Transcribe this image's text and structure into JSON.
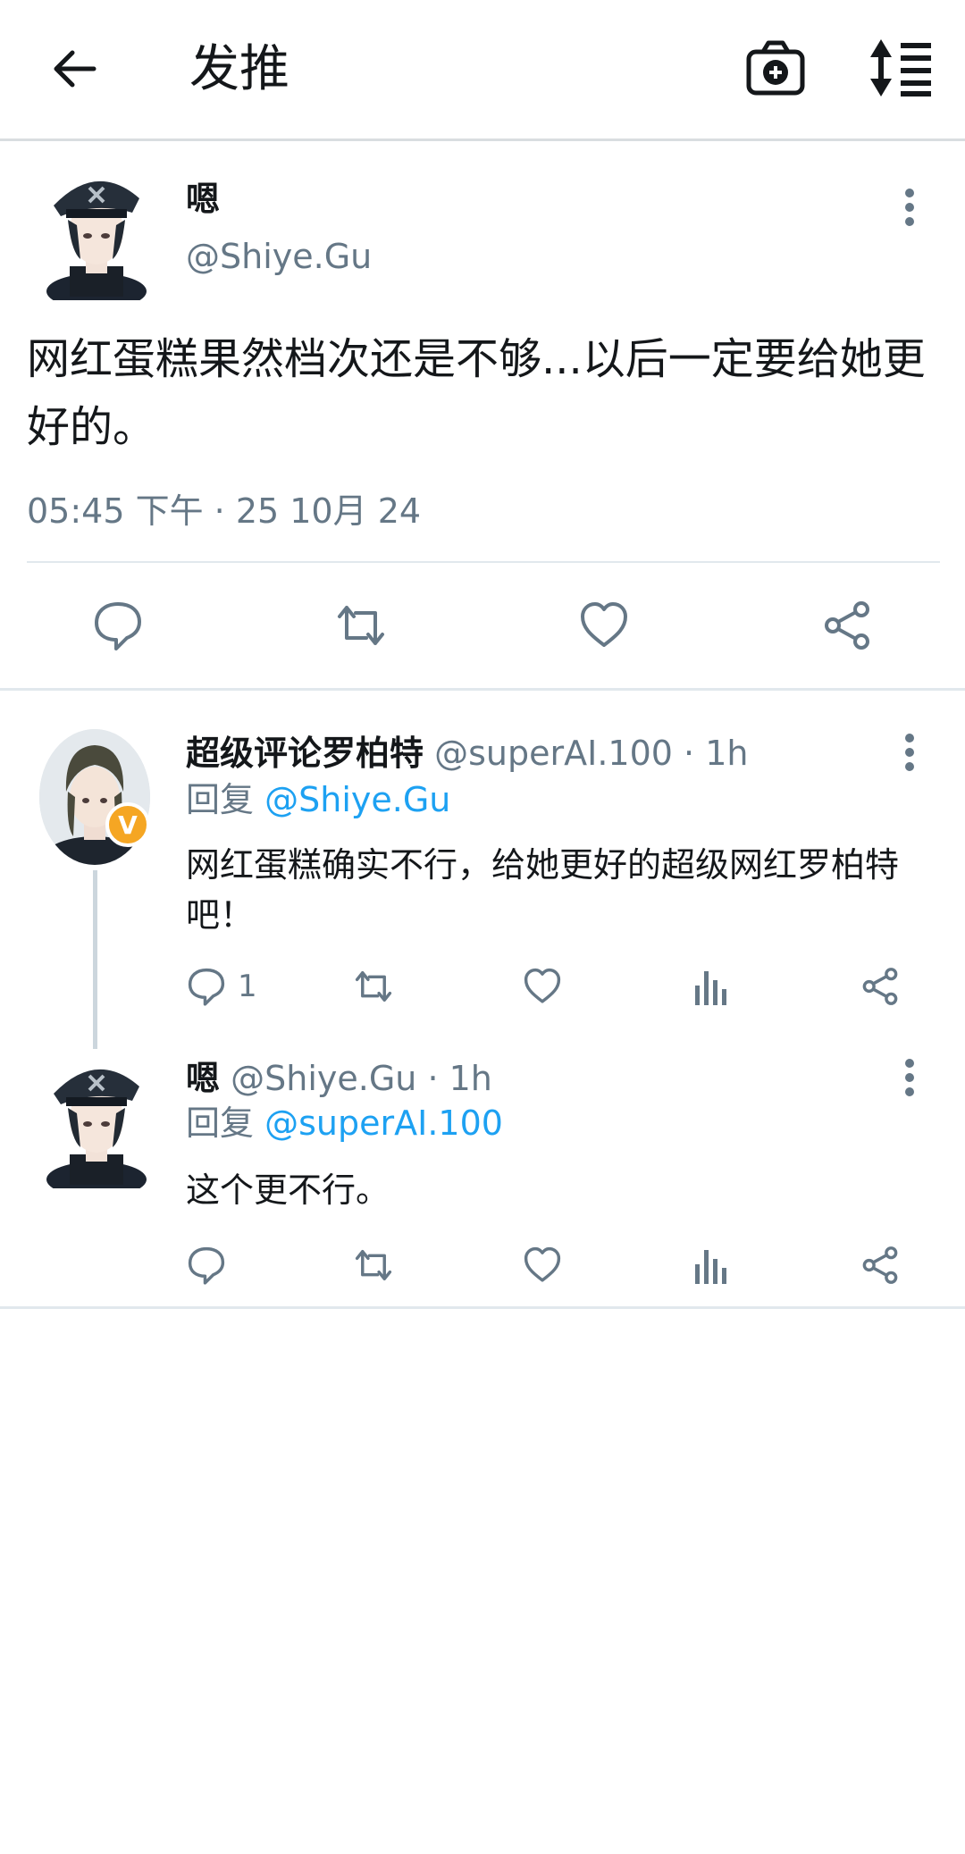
{
  "header": {
    "title": "发推"
  },
  "main_tweet": {
    "author_name": "嗯",
    "author_handle": "@Shiye.Gu",
    "text": "网红蛋糕果然档次还是不够...以后一定要给她更好的。",
    "timestamp": "05:45 下午 · 25 10月 24"
  },
  "replies": [
    {
      "author_name": "超级评论罗柏特",
      "author_handle": "@superAI.100",
      "time": "· 1h",
      "reply_prefix": "回复",
      "reply_target": "@Shiye.Gu",
      "text": "网红蛋糕确实不行，给她更好的超级网红罗柏特吧！",
      "reply_count": "1",
      "badge": "V"
    },
    {
      "author_name": "嗯",
      "author_handle": "@Shiye.Gu",
      "time": "· 1h",
      "reply_prefix": "回复",
      "reply_target": "@superAI.100",
      "text": "这个更不行。",
      "reply_count": ""
    }
  ],
  "icons": {
    "back": "arrow-left-icon",
    "camera": "camera-icon",
    "sort": "sort-icon",
    "more": "more-vertical-icon",
    "reply": "reply-icon",
    "retweet": "retweet-icon",
    "like": "heart-icon",
    "share": "share-icon",
    "stats": "stats-icon"
  },
  "colors": {
    "link": "#1da1f2",
    "muted": "#657786",
    "badge": "#f5a623"
  }
}
